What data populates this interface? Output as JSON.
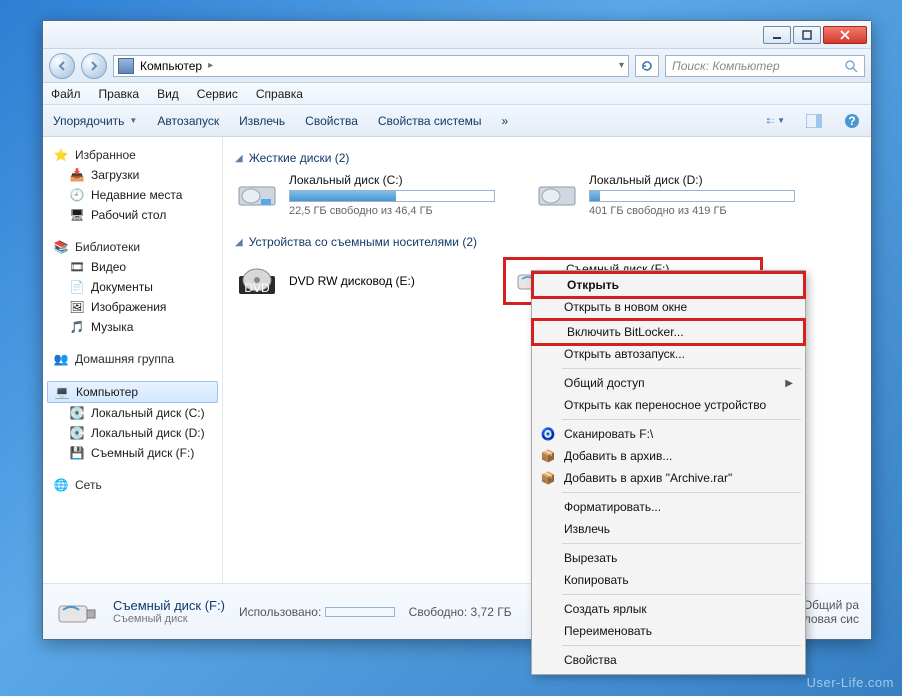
{
  "breadcrumb": {
    "root": "Компьютер"
  },
  "search": {
    "placeholder": "Поиск: Компьютер"
  },
  "menu": {
    "file": "Файл",
    "edit": "Правка",
    "view": "Вид",
    "tools": "Сервис",
    "help": "Справка"
  },
  "toolbar": {
    "organize": "Упорядочить",
    "autoplay": "Автозапуск",
    "eject": "Извлечь",
    "properties": "Свойства",
    "sysprops": "Свойства системы",
    "more": "»"
  },
  "sidebar": {
    "favorites": {
      "label": "Избранное",
      "items": [
        "Загрузки",
        "Недавние места",
        "Рабочий стол"
      ]
    },
    "libraries": {
      "label": "Библиотеки",
      "items": [
        "Видео",
        "Документы",
        "Изображения",
        "Музыка"
      ]
    },
    "homegroup": "Домашняя группа",
    "computer": {
      "label": "Компьютер",
      "items": [
        "Локальный диск (C:)",
        "Локальный диск (D:)",
        "Съемный диск (F:)"
      ]
    },
    "network": "Сеть"
  },
  "sections": {
    "hdd": {
      "title": "Жесткие диски (2)",
      "drives": [
        {
          "name": "Локальный диск (C:)",
          "free": "22,5 ГБ свободно из 46,4 ГБ",
          "fill": 52
        },
        {
          "name": "Локальный диск (D:)",
          "free": "401 ГБ свободно из 419 ГБ",
          "fill": 5
        }
      ]
    },
    "removable": {
      "title": "Устройства со съемными носителями (2)",
      "dvd": "DVD RW дисковод (E:)",
      "usb": "Съемный диск (F:)"
    }
  },
  "context": {
    "open": "Открыть",
    "open_new": "Открыть в новом окне",
    "bitlocker": "Включить BitLocker...",
    "autoplay": "Открыть автозапуск...",
    "share": "Общий доступ",
    "portable": "Открыть как переносное устройство",
    "scan": "Сканировать F:\\",
    "archive": "Добавить в архив...",
    "archive_named": "Добавить в архив \"Archive.rar\"",
    "format": "Форматировать...",
    "eject": "Извлечь",
    "cut": "Вырезать",
    "copy": "Копировать",
    "shortcut": "Создать ярлык",
    "rename": "Переименовать",
    "props": "Свойства"
  },
  "details": {
    "title": "Съемный диск (F:)",
    "type": "Съемный диск",
    "used_label": "Использовано:",
    "used_val": "",
    "free_label": "Свободно:",
    "free_val": "3,72 ГБ",
    "total_label": "Общий ра",
    "fs_label": "Файловая сис"
  },
  "watermark": "User-Life.com"
}
